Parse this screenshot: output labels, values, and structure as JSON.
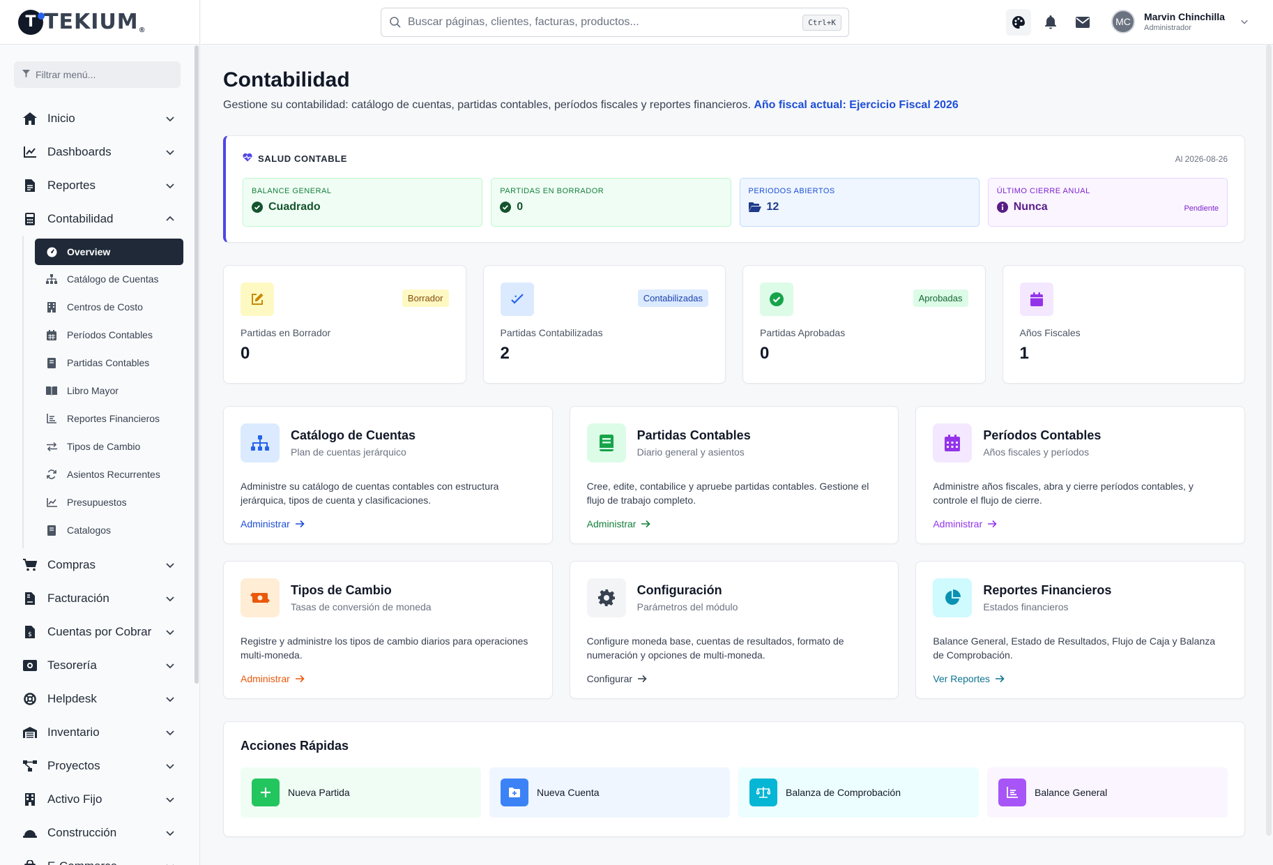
{
  "brand": {
    "name": "TEKIUM",
    "mark": "T",
    "registered": "®"
  },
  "sidebar": {
    "filter_placeholder": "Filtrar menú...",
    "items_before": [
      {
        "label": "Inicio",
        "icon": "home-icon"
      },
      {
        "label": "Dashboards",
        "icon": "chart-line-icon"
      },
      {
        "label": "Reportes",
        "icon": "file-icon"
      }
    ],
    "accounting": {
      "label": "Contabilidad",
      "icon": "calculator-icon",
      "subitems": [
        {
          "label": "Overview",
          "icon": "gauge-icon",
          "active": true
        },
        {
          "label": "Catálogo de Cuentas",
          "icon": "sitemap-icon"
        },
        {
          "label": "Centros de Costo",
          "icon": "building-icon"
        },
        {
          "label": "Períodos Contables",
          "icon": "calendar-icon"
        },
        {
          "label": "Partidas Contables",
          "icon": "book-icon"
        },
        {
          "label": "Libro Mayor",
          "icon": "open-book-icon"
        },
        {
          "label": "Reportes Financieros",
          "icon": "chart-bar-icon"
        },
        {
          "label": "Tipos de Cambio",
          "icon": "exchange-icon"
        },
        {
          "label": "Asientos Recurrentes",
          "icon": "sync-icon"
        },
        {
          "label": "Presupuestos",
          "icon": "chart-line-icon"
        },
        {
          "label": "Catalogos",
          "icon": "book-icon"
        }
      ]
    },
    "items_after": [
      {
        "label": "Compras",
        "icon": "cart-icon"
      },
      {
        "label": "Facturación",
        "icon": "invoice-icon"
      },
      {
        "label": "Cuentas por Cobrar",
        "icon": "invoice-dollar-icon"
      },
      {
        "label": "Tesorería",
        "icon": "money-icon"
      },
      {
        "label": "Helpdesk",
        "icon": "lifebuoy-icon"
      },
      {
        "label": "Inventario",
        "icon": "warehouse-icon"
      },
      {
        "label": "Proyectos",
        "icon": "project-diagram-icon"
      },
      {
        "label": "Activo Fijo",
        "icon": "building-icon"
      },
      {
        "label": "Construcción",
        "icon": "helmet-icon"
      },
      {
        "label": "E-Commerce",
        "icon": "shopping-bag-icon"
      }
    ]
  },
  "topbar": {
    "search_placeholder": "Buscar páginas, clientes, facturas, productos...",
    "shortcut": "Ctrl+K",
    "user": {
      "initials": "MC",
      "name": "Marvin Chinchilla",
      "role": "Administrador"
    }
  },
  "page": {
    "title": "Contabilidad",
    "description": "Gestione su contabilidad: catálogo de cuentas, partidas contables, períodos fiscales y reportes financieros.",
    "fiscal_year_link": "Año fiscal actual: Ejercicio Fiscal 2026"
  },
  "health": {
    "title": "SALUD CONTABLE",
    "date": "Al 2026-08-26",
    "cards": [
      {
        "label": "BALANCE GENERAL",
        "value": "Cuadrado",
        "icon": "check-circle-icon",
        "tone": "green"
      },
      {
        "label": "PARTIDAS EN BORRADOR",
        "value": "0",
        "icon": "check-circle-icon",
        "tone": "green"
      },
      {
        "label": "PERIODOS ABIERTOS",
        "value": "12",
        "icon": "folder-open-icon",
        "tone": "blue"
      },
      {
        "label": "ÚLTIMO CIERRE ANUAL",
        "value": "Nunca",
        "icon": "info-circle-icon",
        "tone": "purple",
        "badge": "Pendiente"
      }
    ]
  },
  "stats": [
    {
      "label": "Partidas en Borrador",
      "value": "0",
      "badge": "Borrador",
      "icon": "edit-icon"
    },
    {
      "label": "Partidas Contabilizadas",
      "value": "2",
      "badge": "Contabilizadas",
      "icon": "check-double-icon"
    },
    {
      "label": "Partidas Aprobadas",
      "value": "0",
      "badge": "Aprobadas",
      "icon": "check-circle-icon"
    },
    {
      "label": "Años Fiscales",
      "value": "1",
      "badge": "",
      "icon": "calendar-icon"
    }
  ],
  "modules": [
    {
      "title": "Catálogo de Cuentas",
      "subtitle": "Plan de cuentas jerárquico",
      "description": "Administre su catálogo de cuentas contables con estructura jerárquica, tipos de cuenta y clasificaciones.",
      "link": "Administrar",
      "icon": "sitemap-icon"
    },
    {
      "title": "Partidas Contables",
      "subtitle": "Diario general y asientos",
      "description": "Cree, edite, contabilice y apruebe partidas contables. Gestione el flujo de trabajo completo.",
      "link": "Administrar",
      "icon": "book-icon"
    },
    {
      "title": "Períodos Contables",
      "subtitle": "Años fiscales y períodos",
      "description": "Administre años fiscales, abra y cierre períodos contables, y controle el flujo de cierre.",
      "link": "Administrar",
      "icon": "calendar-icon"
    },
    {
      "title": "Tipos de Cambio",
      "subtitle": "Tasas de conversión de moneda",
      "description": "Registre y administre los tipos de cambio diarios para operaciones multi-moneda.",
      "link": "Administrar",
      "icon": "money-exchange-icon"
    },
    {
      "title": "Configuración",
      "subtitle": "Parámetros del módulo",
      "description": "Configure moneda base, cuentas de resultados, formato de numeración y opciones de multi-moneda.",
      "link": "Configurar",
      "icon": "gear-icon"
    },
    {
      "title": "Reportes Financieros",
      "subtitle": "Estados financieros",
      "description": "Balance General, Estado de Resultados, Flujo de Caja y Balanza de Comprobación.",
      "link": "Ver Reportes",
      "icon": "pie-chart-icon"
    }
  ],
  "quick_actions": {
    "title": "Acciones Rápidas",
    "items": [
      {
        "label": "Nueva Partida",
        "icon": "plus-icon"
      },
      {
        "label": "Nueva Cuenta",
        "icon": "folder-plus-icon"
      },
      {
        "label": "Balanza de Comprobación",
        "icon": "scale-icon"
      },
      {
        "label": "Balance General",
        "icon": "chart-bar-icon"
      }
    ]
  },
  "colors": {
    "accent": "#4f46e5",
    "sidebar_active": "#1f2937",
    "link_blue": "#1d4ed8",
    "green": "#16a34a",
    "purple": "#9333ea",
    "orange": "#ea580c",
    "teal": "#0891b2"
  }
}
